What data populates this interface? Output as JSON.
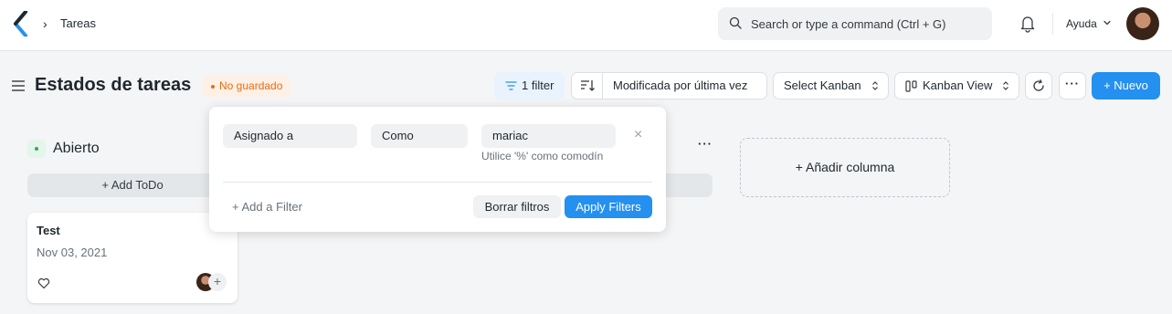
{
  "navbar": {
    "breadcrumb_sep": "›",
    "breadcrumb": "Tareas",
    "search_placeholder": "Search or type a command (Ctrl + G)",
    "help_label": "Ayuda"
  },
  "header": {
    "title": "Estados de tareas",
    "unsaved_badge": "No guardado",
    "filter_label": "1 filter",
    "sort_label": "Modificada por última vez",
    "kanban_select": "Select Kanban",
    "view_select": "Kanban View",
    "more_label": "···",
    "new_label": "+ Nuevo"
  },
  "board": {
    "column": {
      "title": "Abierto",
      "add_label": "+ Add ToDo"
    },
    "column2_more": "···",
    "card": {
      "title": "Test",
      "date": "Nov 03, 2021",
      "plus": "+"
    },
    "add_column_label": "+ Añadir columna"
  },
  "filter_popover": {
    "field": "Asignado a",
    "condition": "Como",
    "value": "mariac",
    "hint": "Utilice '%' como comodín",
    "remove": "×",
    "add_filter": "+ Add a Filter",
    "clear_label": "Borrar filtros",
    "apply_label": "Apply Filters"
  },
  "colors": {
    "primary": "#2490ef",
    "unsaved_bg": "#fff0e6",
    "unsaved_text": "#e86c13",
    "status_green": "#30a66d"
  }
}
